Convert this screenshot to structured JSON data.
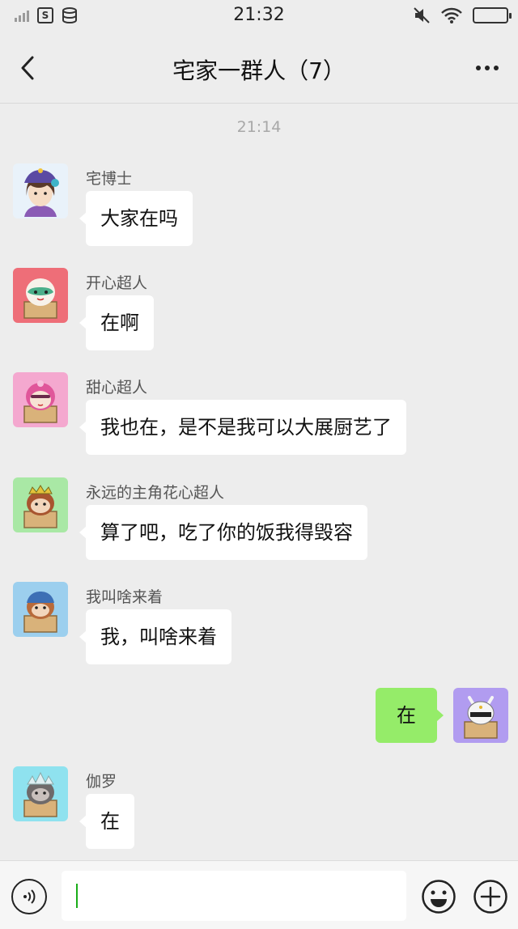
{
  "status_bar": {
    "time": "21:32",
    "sim_label": "S"
  },
  "nav": {
    "title": "宅家一群人（7）"
  },
  "chat": {
    "timestamp": "21:14",
    "messages": [
      {
        "sender": "宅博士",
        "text": "大家在吗",
        "avatar_color": "#e9f2fa"
      },
      {
        "sender": "开心超人",
        "text": "在啊",
        "avatar_color": "#ee6e78"
      },
      {
        "sender": "甜心超人",
        "text": "我也在，是不是我可以大展厨艺了",
        "avatar_color": "#f4a8cf"
      },
      {
        "sender": "永远的主角花心超人",
        "text": "算了吧，吃了你的饭我得毁容",
        "avatar_color": "#a9e8a5"
      },
      {
        "sender": "我叫啥来着",
        "text": "我，叫啥来着",
        "avatar_color": "#9ccfee"
      },
      {
        "sender": "",
        "text": "在",
        "avatar_color": "#b19cf0",
        "outgoing": true
      },
      {
        "sender": "伽罗",
        "text": "在",
        "avatar_color": "#8fe2ef"
      }
    ]
  },
  "input": {
    "value": ""
  },
  "colors": {
    "background": "#ededed",
    "outgoing_bubble": "#95ec69",
    "incoming_bubble": "#ffffff",
    "cursor": "#1aad19"
  },
  "icons": [
    "signal-icon",
    "sim-icon",
    "data-icon",
    "mute-icon",
    "wifi-icon",
    "battery-icon",
    "back-icon",
    "more-icon",
    "voice-icon",
    "emoji-icon",
    "plus-icon"
  ]
}
